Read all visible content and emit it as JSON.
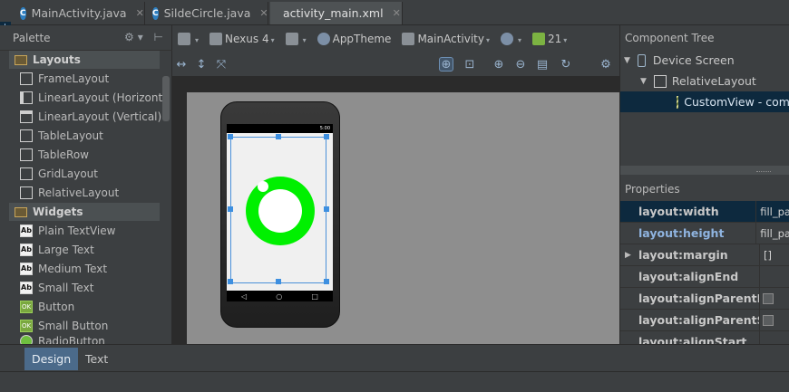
{
  "tabs": [
    {
      "label": "MainActivity.java",
      "icon": "C"
    },
    {
      "label": "SildeCircle.java",
      "icon": "C"
    },
    {
      "label": "activity_main.xml",
      "icon": "xml"
    }
  ],
  "palette": {
    "title": "Palette",
    "layouts_group": "Layouts",
    "layouts": [
      "FrameLayout",
      "LinearLayout (Horizontal)",
      "LinearLayout (Vertical)",
      "TableLayout",
      "TableRow",
      "GridLayout",
      "RelativeLayout"
    ],
    "widgets_group": "Widgets",
    "widgets": [
      "Plain TextView",
      "Large Text",
      "Medium Text",
      "Small Text",
      "Button",
      "Small Button",
      "RadioButton"
    ],
    "text_icon": "Ab",
    "button_icon": "OK"
  },
  "toolbar": {
    "device": "Nexus 4",
    "theme": "AppTheme",
    "activity": "MainActivity",
    "api": "21"
  },
  "device_preview": {
    "status_time": "5:00",
    "nav": [
      "◁",
      "○",
      "□"
    ],
    "ring_color": "#00f000"
  },
  "component_tree": {
    "title": "Component Tree",
    "items": [
      "Device Screen",
      "RelativeLayout",
      "CustomView - com"
    ]
  },
  "properties": {
    "title": "Properties",
    "rows": [
      {
        "name": "layout:width",
        "value": "fill_pa"
      },
      {
        "name": "layout:height",
        "value": "fill_pa"
      },
      {
        "name": "layout:margin",
        "value": "[]"
      },
      {
        "name": "layout:alignEnd",
        "value": ""
      },
      {
        "name": "layout:alignParentEnd",
        "value": ""
      },
      {
        "name": "layout:alignParentStart",
        "value": ""
      },
      {
        "name": "layout:alignStart",
        "value": ""
      }
    ]
  },
  "bottom_tabs": [
    "Design",
    "Text"
  ]
}
